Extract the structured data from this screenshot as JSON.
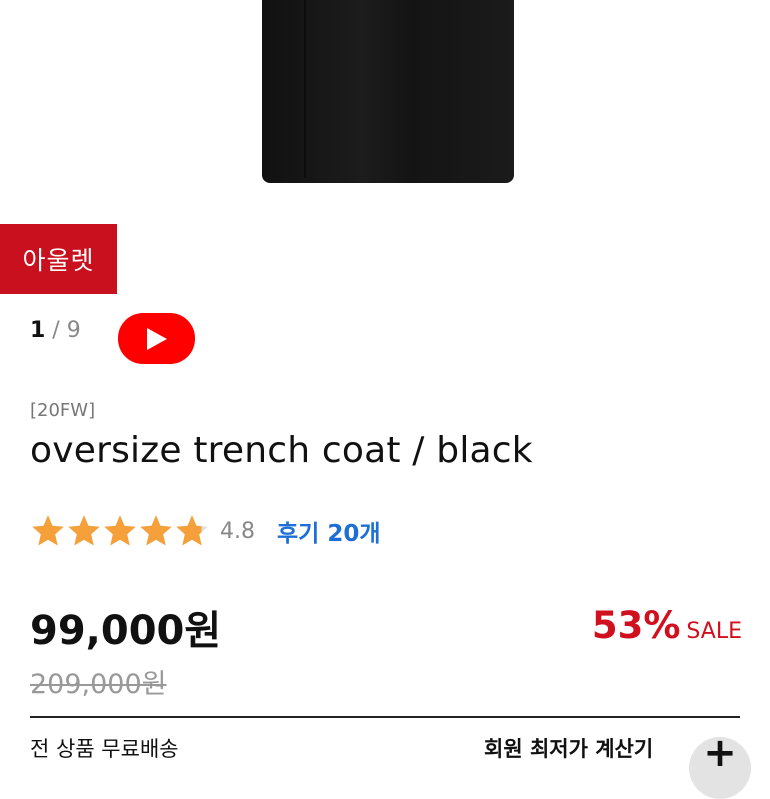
{
  "badge": {
    "label": "아울렛",
    "color": "#c8101e"
  },
  "gallery": {
    "current": "1",
    "separator": " / ",
    "total": "9",
    "video_icon": "youtube-play-icon"
  },
  "product": {
    "season": "[20FW]",
    "title": "oversize trench coat / black"
  },
  "rating": {
    "stars": 4.8,
    "max": 5,
    "value": "4.8",
    "review_label": "후기 20개"
  },
  "pricing": {
    "price": "99,000원",
    "discount_percent": "53%",
    "sale_label": "SALE",
    "original_price": "209,000원"
  },
  "shipping": {
    "label": "전 상품 무료배송"
  },
  "member": {
    "calc_label": "회원 최저가 계산기",
    "toggle_icon": "plus-icon"
  },
  "colors": {
    "accent": "#d0101e",
    "link": "#1d6fd6",
    "star": "#f5a03a"
  }
}
